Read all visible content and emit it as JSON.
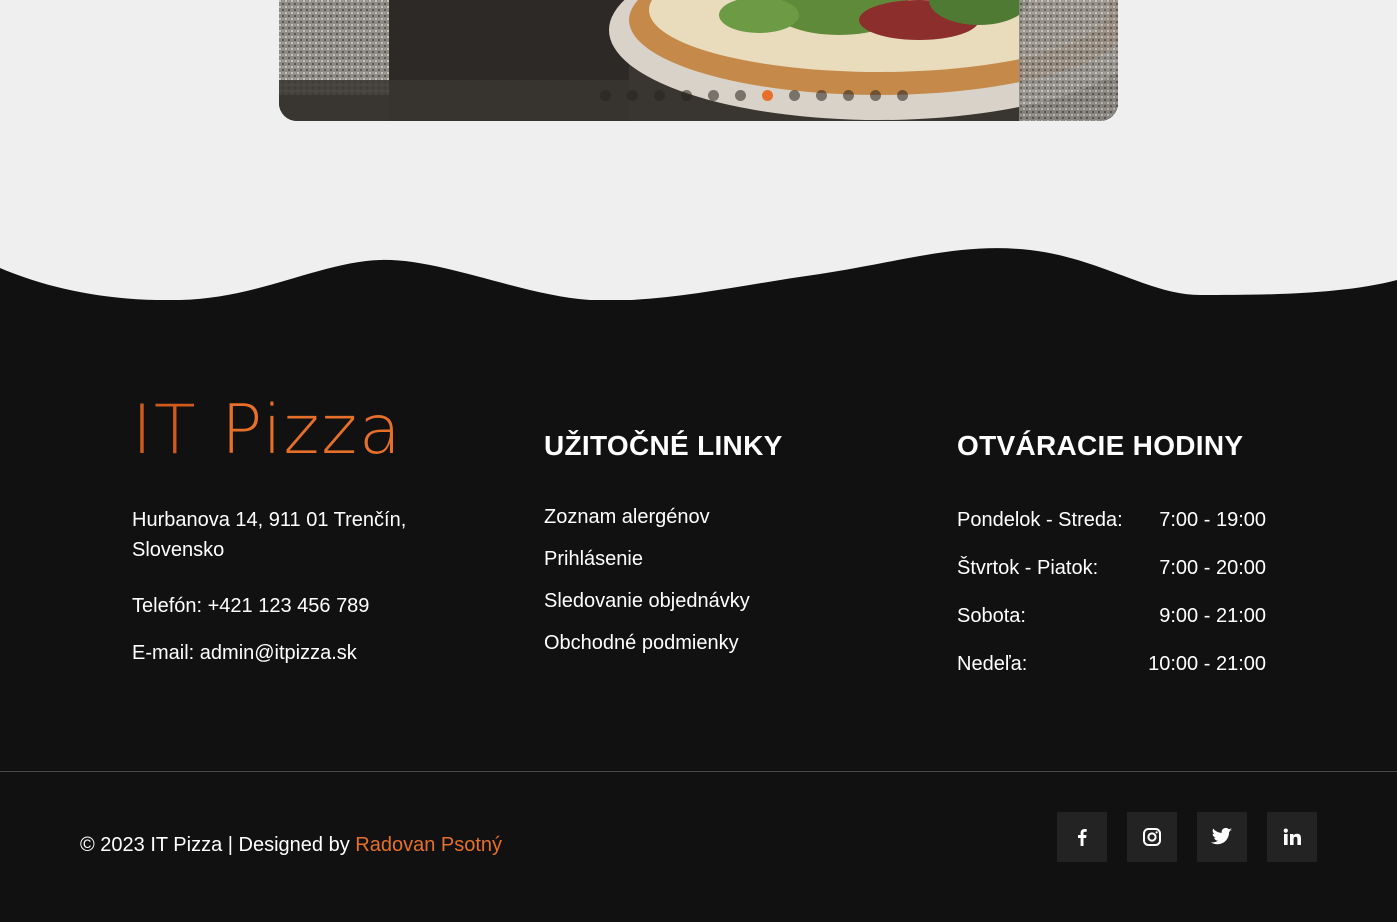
{
  "carousel": {
    "slide_count": 12,
    "active_index": 6,
    "accent": "#e6702a"
  },
  "footer": {
    "brand": {
      "logo_prefix": "IT",
      "logo_suffix": "Pizza",
      "address_line1": "Hurbanova 14, 911 01 Trenčín,",
      "address_line2": "Slovensko",
      "phone": "Telefón: +421 123 456 789",
      "email": "E-mail: admin@itpizza.sk"
    },
    "links": {
      "title": "UŽITOČNÉ LINKY",
      "items": [
        {
          "label": "Zoznam alergénov"
        },
        {
          "label": "Prihlásenie"
        },
        {
          "label": "Sledovanie objednávky"
        },
        {
          "label": "Obchodné podmienky"
        }
      ]
    },
    "hours": {
      "title": "OTVÁRACIE HODINY",
      "rows": [
        {
          "day": "Pondelok - Streda:",
          "time": "7:00 - 19:00"
        },
        {
          "day": "Štvrtok - Piatok:",
          "time": "7:00 - 20:00"
        },
        {
          "day": "Sobota:",
          "time": "9:00 - 21:00"
        },
        {
          "day": "Nedeľa:",
          "time": "10:00 - 21:00"
        }
      ]
    },
    "bottom": {
      "copyright": "© 2023 IT Pizza | Designed by ",
      "author": "Radovan Psotný"
    },
    "social": [
      {
        "icon": "facebook-icon"
      },
      {
        "icon": "instagram-icon"
      },
      {
        "icon": "twitter-icon"
      },
      {
        "icon": "linkedin-icon"
      }
    ],
    "colors": {
      "background": "#111111",
      "accent": "#e6702a",
      "page_background": "#efefef"
    }
  }
}
